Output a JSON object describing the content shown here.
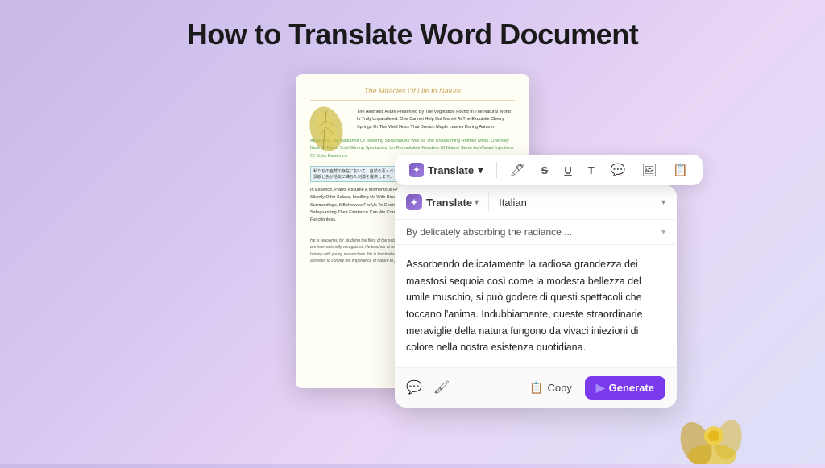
{
  "page": {
    "title": "How to Translate Word Document",
    "background": "linear-gradient(135deg, #c9b8e8, #d4c5f0, #e8d5f5, #dde0f8)"
  },
  "doc": {
    "header": "The Miracles Of Life In Nature",
    "body_text_1": "The Aesthetic Allure Presented By The Vegetation Found In The Natural World Is Truly Unparalleled. One Cannot Help But Marvel At The Exquisite Cherry Springs Or The Vivid Hues That Drench Maple Leaves During Autumn.",
    "highlight_green": "Absorbing The Radiance Of Towering Sequoias As Well As The Unassuming Humble Moss. One May Bask In These Soul-Stirring Spectacles. Un Remarkable Wonders Of Nature Serve As Vibrant Injections Of Color Existence.",
    "highlight_box": "私たちの自然の存在において、自然の素くべき 景観と色が活気に満ちた刺激を提供します。",
    "body_text_2": "In Essence, Plants Assume A Momentous Role Within Our Lives Beyond Being Companions. They Silently Offer Solace, Instilling Us With Boundless Vigor. Grasping The Invaluable Essence Of Our Surroundings, It Behooves For Us To Cherish Every Thriving Tree Or Blossom And Ensure Their Through Safeguarding Their Existence Can We Continue To Flourish Our Lives Would Be Rendered Functionless.",
    "cursive_text": "He is renowned for studying the flora of the natural world. He works in plant classification, taxonomy, and ecology are internationally recognized. He teaches at multiple universities and shares his knowledge and passion for botany with young researchers. He is fascinated by the diversity and beauty of plants, and continues his writing activities to convey the importance of nature to people."
  },
  "toolbar": {
    "translate_label": "Translate",
    "chevron": "▾",
    "icons": [
      "pen",
      "strikethrough",
      "underline",
      "text",
      "comment",
      "image",
      "copy"
    ]
  },
  "translate_panel": {
    "translate_label": "Translate",
    "chevron": "▾",
    "language": "Italian",
    "source_text": "By delicately absorbing the radiance ...",
    "translated_text": "Assorbendo delicatamente la radiosa grandezza dei maestosi sequoia così come la modesta bellezza del umile muschio, si può godere di questi spettacoli che toccano l'anima. Indubbiamente, queste straordinarie meraviglie della natura fungono da vivaci iniezioni di colore nella nostra esistenza quotidiana.",
    "copy_label": "Copy",
    "generate_label": "Generate"
  }
}
